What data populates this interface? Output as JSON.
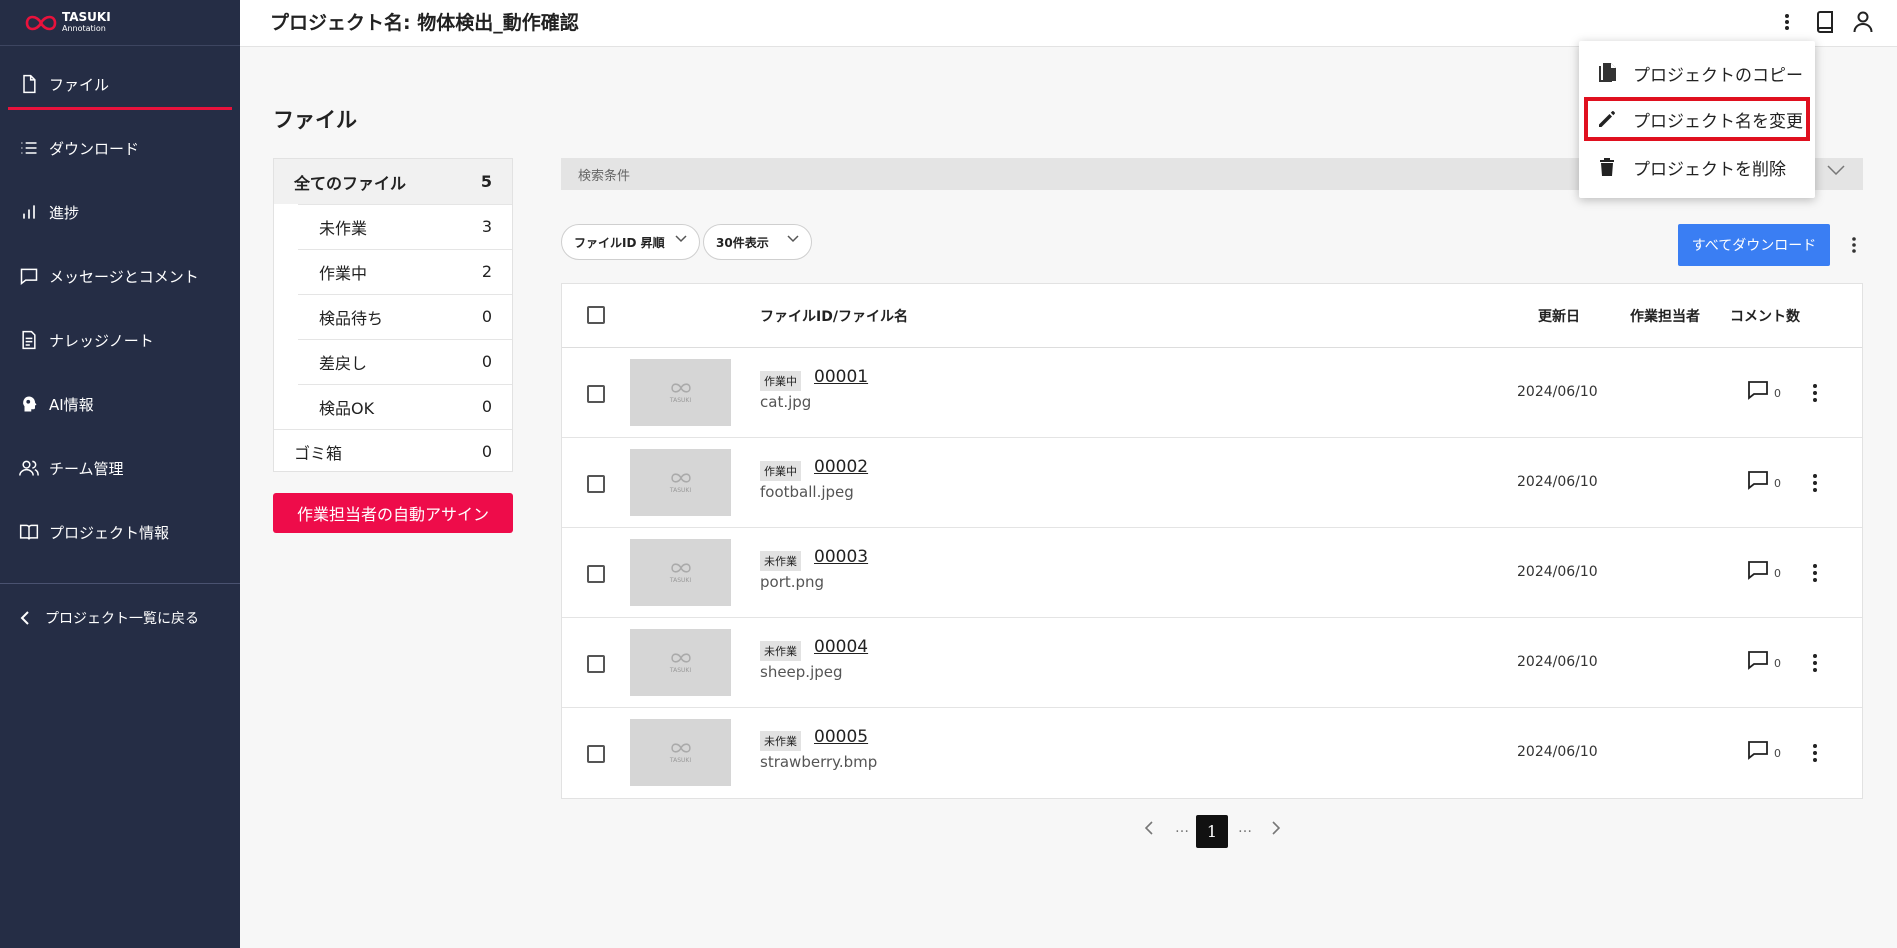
{
  "sidebar": {
    "logo": {
      "line1": "TASUKI",
      "line2": "Annotation"
    },
    "items": [
      {
        "label": "ファイル",
        "icon": "file-icon"
      },
      {
        "label": "ダウンロード",
        "icon": "list-icon"
      },
      {
        "label": "進捗",
        "icon": "bar-chart-icon"
      },
      {
        "label": "メッセージとコメント",
        "icon": "message-icon"
      },
      {
        "label": "ナレッジノート",
        "icon": "document-icon"
      },
      {
        "label": "AI情報",
        "icon": "ai-head-icon"
      },
      {
        "label": "チーム管理",
        "icon": "team-icon"
      },
      {
        "label": "プロジェクト情報",
        "icon": "book-icon"
      }
    ],
    "back": "プロジェクト一覧に戻る"
  },
  "header": {
    "title": "プロジェクト名: 物体検出_動作確認"
  },
  "page": {
    "title": "ファイル"
  },
  "filters": {
    "all": {
      "label": "全てのファイル",
      "count": "5"
    },
    "sub": [
      {
        "label": "未作業",
        "count": "3"
      },
      {
        "label": "作業中",
        "count": "2"
      },
      {
        "label": "検品待ち",
        "count": "0"
      },
      {
        "label": "差戻し",
        "count": "0"
      },
      {
        "label": "検品OK",
        "count": "0"
      }
    ],
    "trash": {
      "label": "ゴミ箱",
      "count": "0"
    }
  },
  "assign_button": "作業担当者の自動アサイン",
  "search": {
    "label": "検索条件"
  },
  "sort": {
    "label": "ファイルID 昇順"
  },
  "per_page": {
    "label": "30件表示"
  },
  "download_all": "すべてダウンロード",
  "table": {
    "headers": {
      "file": "ファイルID/ファイル名",
      "updated": "更新日",
      "assignee": "作業担当者",
      "comments": "コメント数"
    },
    "thumb_label": "TASUKI",
    "rows": [
      {
        "status": "作業中",
        "id": "00001",
        "name": "cat.jpg",
        "date": "2024/06/10",
        "comments": "0"
      },
      {
        "status": "作業中",
        "id": "00002",
        "name": "football.jpeg",
        "date": "2024/06/10",
        "comments": "0"
      },
      {
        "status": "未作業",
        "id": "00003",
        "name": "port.png",
        "date": "2024/06/10",
        "comments": "0"
      },
      {
        "status": "未作業",
        "id": "00004",
        "name": "sheep.jpeg",
        "date": "2024/06/10",
        "comments": "0"
      },
      {
        "status": "未作業",
        "id": "00005",
        "name": "strawberry.bmp",
        "date": "2024/06/10",
        "comments": "0"
      }
    ]
  },
  "pagination": {
    "current": "1",
    "ellipsis": "…"
  },
  "menu": {
    "items": [
      {
        "label": "プロジェクトのコピー",
        "icon": "copy-icon"
      },
      {
        "label": "プロジェクト名を変更",
        "icon": "pencil-icon"
      },
      {
        "label": "プロジェクトを削除",
        "icon": "trash-icon"
      }
    ]
  },
  "colors": {
    "sidebar": "#252d45",
    "accent": "#ee0c4a",
    "primary": "#3a7ef3",
    "highlight": "#e0101f"
  }
}
